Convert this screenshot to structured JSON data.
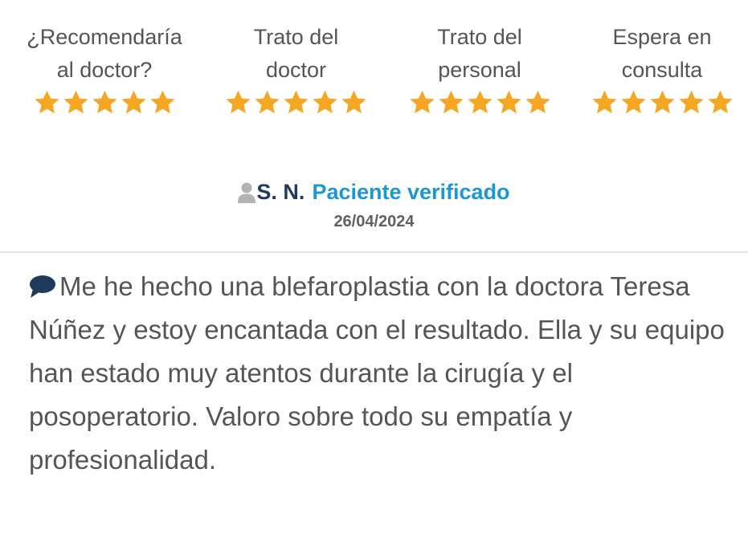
{
  "ratings": [
    {
      "label_line1": "¿Recomendaría",
      "label_line2": "al doctor?",
      "stars": 5,
      "max": 5
    },
    {
      "label_line1": "Trato del",
      "label_line2": "doctor",
      "stars": 5,
      "max": 5
    },
    {
      "label_line1": "Trato del",
      "label_line2": "personal",
      "stars": 5,
      "max": 5
    },
    {
      "label_line1": "Espera en",
      "label_line2": "consulta",
      "stars": 5,
      "max": 5
    }
  ],
  "review": {
    "author": "S. N.",
    "verified_label": "Paciente verificado",
    "date": "26/04/2024",
    "text": "Me he hecho una blefaroplastia con la doctora Teresa Núñez y estoy encantada con el resultado. Ella y su equipo han estado muy atentos durante la cirugía y el posoperatorio. Valoro sobre todo su empatía y profesionalidad."
  },
  "colors": {
    "star": "#f5a623",
    "author_name": "#1f3a5a",
    "verified": "#1c97d4",
    "text": "#555555",
    "user_icon": "#b3b3b3",
    "comment_icon": "#1f3a5a"
  },
  "icons": {
    "star": "star-icon",
    "user": "user-icon",
    "comment": "comment-icon"
  }
}
